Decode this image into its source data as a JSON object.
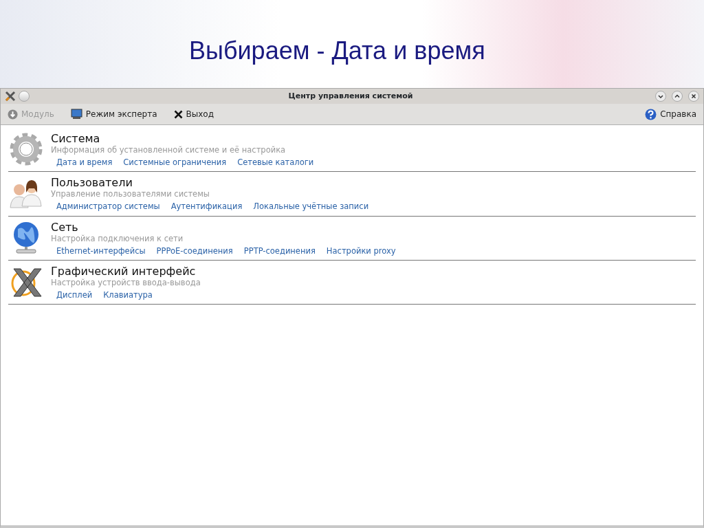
{
  "slide": {
    "title": "Выбираем - Дата и время"
  },
  "window": {
    "title": "Центр управления системой"
  },
  "toolbar": [
    {
      "label": "Модуль",
      "kind": "module",
      "disabled": true
    },
    {
      "label": "Режим эксперта",
      "kind": "expert",
      "disabled": false
    },
    {
      "label": "Выход",
      "kind": "exit",
      "disabled": false
    }
  ],
  "help": {
    "label": "Справка"
  },
  "categories": [
    {
      "kind": "system",
      "title": "Система",
      "description": "Информация об установленной системе и её настройка",
      "links": [
        "Дата и время",
        "Системные ограничения",
        "Сетевые каталоги"
      ]
    },
    {
      "kind": "users",
      "title": "Пользователи",
      "description": "Управление пользователями системы",
      "links": [
        "Администратор системы",
        "Аутентификация",
        "Локальные учётные записи"
      ]
    },
    {
      "kind": "network",
      "title": "Сеть",
      "description": "Настройка подключения к сети",
      "links": [
        "Ethernet-интерфейсы",
        "PPPoE-соединения",
        "PPTP-соединения",
        "Настройки proxy"
      ]
    },
    {
      "kind": "graphics",
      "title": "Графический интерфейс",
      "description": "Настройка устройств ввода-вывода",
      "links": [
        "Дисплей",
        "Клавиатура"
      ]
    }
  ]
}
